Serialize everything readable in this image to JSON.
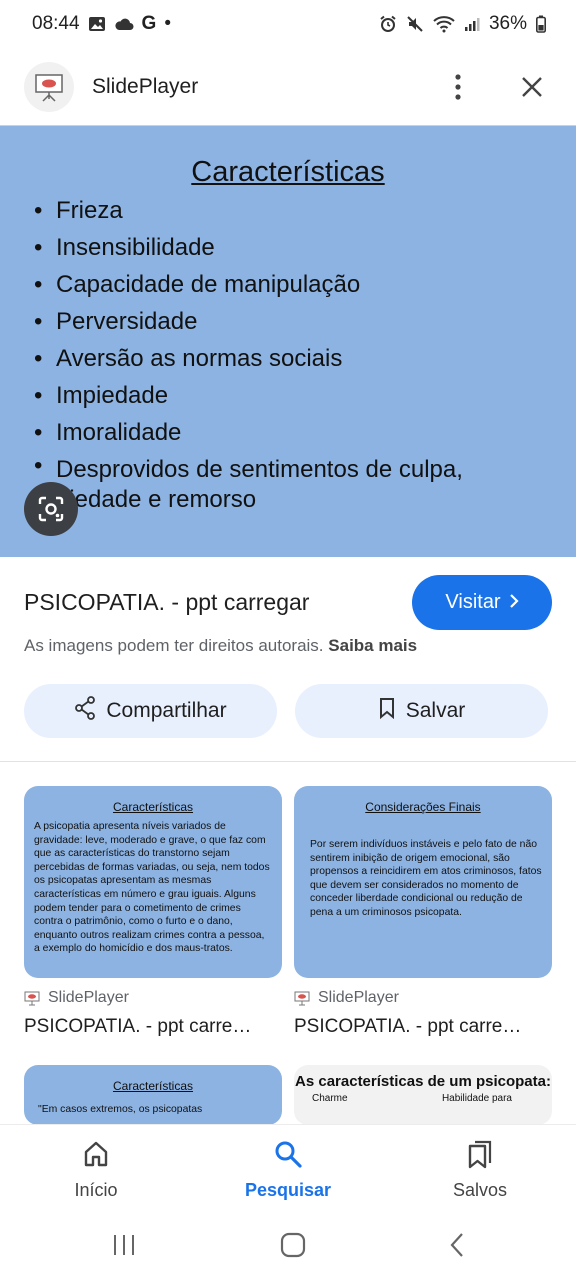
{
  "status_bar": {
    "time": "08:44",
    "g_label": "G",
    "dot": "•",
    "battery": "36%"
  },
  "header": {
    "site_name": "SlidePlayer"
  },
  "hero": {
    "title": "Características",
    "items": [
      "Frieza",
      "Insensibilidade",
      "Capacidade de manipulação",
      "Perversidade",
      "Aversão as normas sociais",
      "Impiedade",
      "Imoralidade",
      "Desprovidos de sentimentos de culpa, piedade e remorso"
    ],
    "background_color": "#8db3e2"
  },
  "result": {
    "title": "PSICOPATIA. - ppt carregar",
    "visit_label": "Visitar",
    "copyright_text": "As imagens podem ter direitos autorais.",
    "learn_more": "Saiba mais",
    "share_label": "Compartilhar",
    "save_label": "Salvar"
  },
  "related": [
    {
      "mini_title": "Características",
      "mini_body": "A psicopatia apresenta níveis variados de gravidade: leve, moderado e grave, o que faz com que as características do transtorno sejam percebidas de formas variadas, ou seja, nem todos os psicopatas apresentam as mesmas características em número e grau iguais. Alguns podem tender para o cometimento de crimes contra o patrimônio, como o furto e o dano, enquanto outros realizam crimes contra a pessoa, a exemplo do homicídio e dos maus-tratos.",
      "source": "SlidePlayer",
      "caption": "PSICOPATIA. - ppt carre…"
    },
    {
      "mini_title": "Considerações Finais",
      "mini_body": "Por serem indivíduos instáveis e pelo fato de não sentirem inibição de origem emocional, são propensos a reincidirem em atos criminosos, fatos que devem ser considerados no momento de conceder liberdade condicional ou redução de pena a um criminosos psicopata.",
      "source": "SlidePlayer",
      "caption": "PSICOPATIA. - ppt carre…"
    },
    {
      "mini_title": "Características",
      "mini_body": "\"Em casos extremos, os psicopatas"
    },
    {
      "big_title": "As características de um psicopata:",
      "col_left": "Charme",
      "col_right": "Habilidade para"
    }
  ],
  "bottom_nav": {
    "home": "Início",
    "search": "Pesquisar",
    "saved": "Salvos"
  },
  "colors": {
    "accent": "#1a73e8",
    "slide_blue": "#8db3e2",
    "pill_bg": "#e8f0fe"
  }
}
